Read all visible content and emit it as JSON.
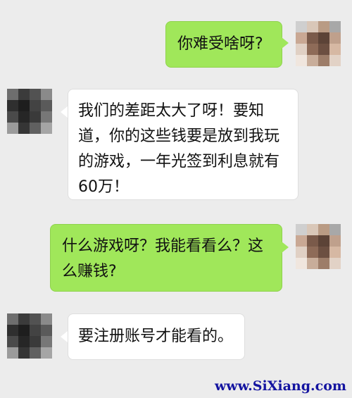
{
  "messages": [
    {
      "side": "right",
      "text": "你难受啥呀?"
    },
    {
      "side": "left",
      "text": "我们的差距太大了呀！要知道，你的这些钱要是放到我玩的游戏，一年光签到利息就有60万！"
    },
    {
      "side": "right",
      "text": "什么游戏呀？我能看看么？这么赚钱?"
    },
    {
      "side": "left",
      "text": "要注册账号才能看的。"
    }
  ],
  "avatars": {
    "self_colors": [
      "#cfcfcf",
      "#d9c7b8",
      "#b99b84",
      "#a8a8a8",
      "#c9a894",
      "#7a5a4a",
      "#5c4337",
      "#bfa08c",
      "#e0d0c4",
      "#8e6b58",
      "#6c4f41",
      "#d6b8a3",
      "#f0e6de",
      "#c8ad9a",
      "#9d7d69",
      "#e2d2c6"
    ],
    "other_colors": [
      "#6e6e6e",
      "#3b3b3b",
      "#525252",
      "#8a8a8a",
      "#2f2f2f",
      "#1e1e1e",
      "#434343",
      "#5a5a5a",
      "#4a4a4a",
      "#262626",
      "#3a3a3a",
      "#777777",
      "#9b9b9b",
      "#353535",
      "#606060",
      "#a5a5a5"
    ]
  },
  "watermark": "www.SiXiang.com"
}
